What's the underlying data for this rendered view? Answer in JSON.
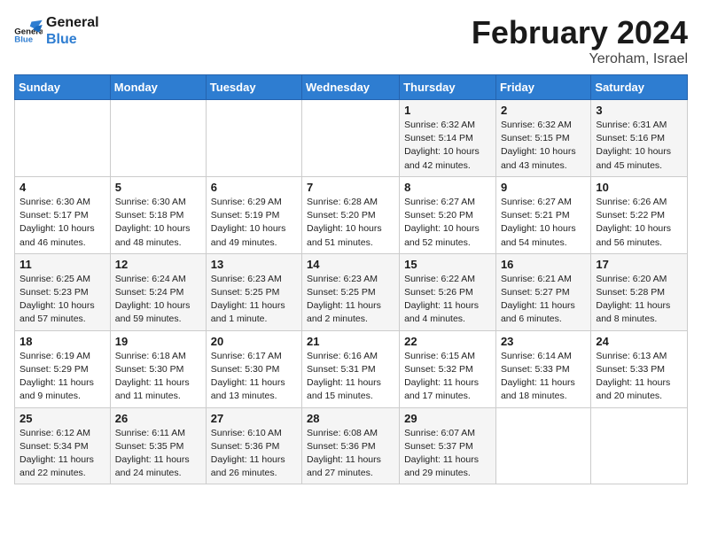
{
  "header": {
    "logo_line1": "General",
    "logo_line2": "Blue",
    "month_title": "February 2024",
    "location": "Yeroham, Israel"
  },
  "weekdays": [
    "Sunday",
    "Monday",
    "Tuesday",
    "Wednesday",
    "Thursday",
    "Friday",
    "Saturday"
  ],
  "weeks": [
    [
      {
        "day": "",
        "info": ""
      },
      {
        "day": "",
        "info": ""
      },
      {
        "day": "",
        "info": ""
      },
      {
        "day": "",
        "info": ""
      },
      {
        "day": "1",
        "info": "Sunrise: 6:32 AM\nSunset: 5:14 PM\nDaylight: 10 hours\nand 42 minutes."
      },
      {
        "day": "2",
        "info": "Sunrise: 6:32 AM\nSunset: 5:15 PM\nDaylight: 10 hours\nand 43 minutes."
      },
      {
        "day": "3",
        "info": "Sunrise: 6:31 AM\nSunset: 5:16 PM\nDaylight: 10 hours\nand 45 minutes."
      }
    ],
    [
      {
        "day": "4",
        "info": "Sunrise: 6:30 AM\nSunset: 5:17 PM\nDaylight: 10 hours\nand 46 minutes."
      },
      {
        "day": "5",
        "info": "Sunrise: 6:30 AM\nSunset: 5:18 PM\nDaylight: 10 hours\nand 48 minutes."
      },
      {
        "day": "6",
        "info": "Sunrise: 6:29 AM\nSunset: 5:19 PM\nDaylight: 10 hours\nand 49 minutes."
      },
      {
        "day": "7",
        "info": "Sunrise: 6:28 AM\nSunset: 5:20 PM\nDaylight: 10 hours\nand 51 minutes."
      },
      {
        "day": "8",
        "info": "Sunrise: 6:27 AM\nSunset: 5:20 PM\nDaylight: 10 hours\nand 52 minutes."
      },
      {
        "day": "9",
        "info": "Sunrise: 6:27 AM\nSunset: 5:21 PM\nDaylight: 10 hours\nand 54 minutes."
      },
      {
        "day": "10",
        "info": "Sunrise: 6:26 AM\nSunset: 5:22 PM\nDaylight: 10 hours\nand 56 minutes."
      }
    ],
    [
      {
        "day": "11",
        "info": "Sunrise: 6:25 AM\nSunset: 5:23 PM\nDaylight: 10 hours\nand 57 minutes."
      },
      {
        "day": "12",
        "info": "Sunrise: 6:24 AM\nSunset: 5:24 PM\nDaylight: 10 hours\nand 59 minutes."
      },
      {
        "day": "13",
        "info": "Sunrise: 6:23 AM\nSunset: 5:25 PM\nDaylight: 11 hours\nand 1 minute."
      },
      {
        "day": "14",
        "info": "Sunrise: 6:23 AM\nSunset: 5:25 PM\nDaylight: 11 hours\nand 2 minutes."
      },
      {
        "day": "15",
        "info": "Sunrise: 6:22 AM\nSunset: 5:26 PM\nDaylight: 11 hours\nand 4 minutes."
      },
      {
        "day": "16",
        "info": "Sunrise: 6:21 AM\nSunset: 5:27 PM\nDaylight: 11 hours\nand 6 minutes."
      },
      {
        "day": "17",
        "info": "Sunrise: 6:20 AM\nSunset: 5:28 PM\nDaylight: 11 hours\nand 8 minutes."
      }
    ],
    [
      {
        "day": "18",
        "info": "Sunrise: 6:19 AM\nSunset: 5:29 PM\nDaylight: 11 hours\nand 9 minutes."
      },
      {
        "day": "19",
        "info": "Sunrise: 6:18 AM\nSunset: 5:30 PM\nDaylight: 11 hours\nand 11 minutes."
      },
      {
        "day": "20",
        "info": "Sunrise: 6:17 AM\nSunset: 5:30 PM\nDaylight: 11 hours\nand 13 minutes."
      },
      {
        "day": "21",
        "info": "Sunrise: 6:16 AM\nSunset: 5:31 PM\nDaylight: 11 hours\nand 15 minutes."
      },
      {
        "day": "22",
        "info": "Sunrise: 6:15 AM\nSunset: 5:32 PM\nDaylight: 11 hours\nand 17 minutes."
      },
      {
        "day": "23",
        "info": "Sunrise: 6:14 AM\nSunset: 5:33 PM\nDaylight: 11 hours\nand 18 minutes."
      },
      {
        "day": "24",
        "info": "Sunrise: 6:13 AM\nSunset: 5:33 PM\nDaylight: 11 hours\nand 20 minutes."
      }
    ],
    [
      {
        "day": "25",
        "info": "Sunrise: 6:12 AM\nSunset: 5:34 PM\nDaylight: 11 hours\nand 22 minutes."
      },
      {
        "day": "26",
        "info": "Sunrise: 6:11 AM\nSunset: 5:35 PM\nDaylight: 11 hours\nand 24 minutes."
      },
      {
        "day": "27",
        "info": "Sunrise: 6:10 AM\nSunset: 5:36 PM\nDaylight: 11 hours\nand 26 minutes."
      },
      {
        "day": "28",
        "info": "Sunrise: 6:08 AM\nSunset: 5:36 PM\nDaylight: 11 hours\nand 27 minutes."
      },
      {
        "day": "29",
        "info": "Sunrise: 6:07 AM\nSunset: 5:37 PM\nDaylight: 11 hours\nand 29 minutes."
      },
      {
        "day": "",
        "info": ""
      },
      {
        "day": "",
        "info": ""
      }
    ]
  ]
}
